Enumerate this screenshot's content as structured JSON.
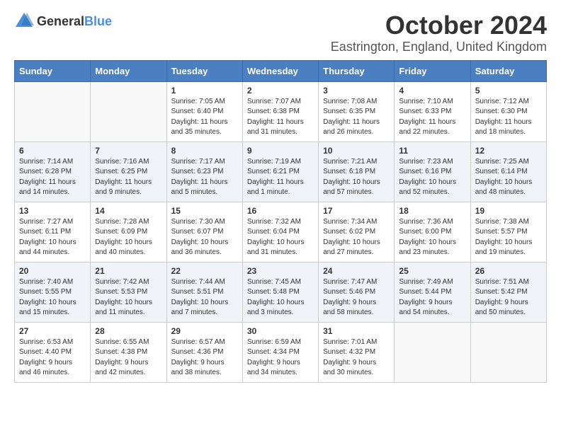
{
  "logo": {
    "text_general": "General",
    "text_blue": "Blue"
  },
  "header": {
    "month": "October 2024",
    "location": "Eastrington, England, United Kingdom"
  },
  "days_of_week": [
    "Sunday",
    "Monday",
    "Tuesday",
    "Wednesday",
    "Thursday",
    "Friday",
    "Saturday"
  ],
  "weeks": [
    [
      {
        "day": null
      },
      {
        "day": null
      },
      {
        "day": "1",
        "sunrise": "Sunrise: 7:05 AM",
        "sunset": "Sunset: 6:40 PM",
        "daylight": "Daylight: 11 hours and 35 minutes."
      },
      {
        "day": "2",
        "sunrise": "Sunrise: 7:07 AM",
        "sunset": "Sunset: 6:38 PM",
        "daylight": "Daylight: 11 hours and 31 minutes."
      },
      {
        "day": "3",
        "sunrise": "Sunrise: 7:08 AM",
        "sunset": "Sunset: 6:35 PM",
        "daylight": "Daylight: 11 hours and 26 minutes."
      },
      {
        "day": "4",
        "sunrise": "Sunrise: 7:10 AM",
        "sunset": "Sunset: 6:33 PM",
        "daylight": "Daylight: 11 hours and 22 minutes."
      },
      {
        "day": "5",
        "sunrise": "Sunrise: 7:12 AM",
        "sunset": "Sunset: 6:30 PM",
        "daylight": "Daylight: 11 hours and 18 minutes."
      }
    ],
    [
      {
        "day": "6",
        "sunrise": "Sunrise: 7:14 AM",
        "sunset": "Sunset: 6:28 PM",
        "daylight": "Daylight: 11 hours and 14 minutes."
      },
      {
        "day": "7",
        "sunrise": "Sunrise: 7:16 AM",
        "sunset": "Sunset: 6:25 PM",
        "daylight": "Daylight: 11 hours and 9 minutes."
      },
      {
        "day": "8",
        "sunrise": "Sunrise: 7:17 AM",
        "sunset": "Sunset: 6:23 PM",
        "daylight": "Daylight: 11 hours and 5 minutes."
      },
      {
        "day": "9",
        "sunrise": "Sunrise: 7:19 AM",
        "sunset": "Sunset: 6:21 PM",
        "daylight": "Daylight: 11 hours and 1 minute."
      },
      {
        "day": "10",
        "sunrise": "Sunrise: 7:21 AM",
        "sunset": "Sunset: 6:18 PM",
        "daylight": "Daylight: 10 hours and 57 minutes."
      },
      {
        "day": "11",
        "sunrise": "Sunrise: 7:23 AM",
        "sunset": "Sunset: 6:16 PM",
        "daylight": "Daylight: 10 hours and 52 minutes."
      },
      {
        "day": "12",
        "sunrise": "Sunrise: 7:25 AM",
        "sunset": "Sunset: 6:14 PM",
        "daylight": "Daylight: 10 hours and 48 minutes."
      }
    ],
    [
      {
        "day": "13",
        "sunrise": "Sunrise: 7:27 AM",
        "sunset": "Sunset: 6:11 PM",
        "daylight": "Daylight: 10 hours and 44 minutes."
      },
      {
        "day": "14",
        "sunrise": "Sunrise: 7:28 AM",
        "sunset": "Sunset: 6:09 PM",
        "daylight": "Daylight: 10 hours and 40 minutes."
      },
      {
        "day": "15",
        "sunrise": "Sunrise: 7:30 AM",
        "sunset": "Sunset: 6:07 PM",
        "daylight": "Daylight: 10 hours and 36 minutes."
      },
      {
        "day": "16",
        "sunrise": "Sunrise: 7:32 AM",
        "sunset": "Sunset: 6:04 PM",
        "daylight": "Daylight: 10 hours and 31 minutes."
      },
      {
        "day": "17",
        "sunrise": "Sunrise: 7:34 AM",
        "sunset": "Sunset: 6:02 PM",
        "daylight": "Daylight: 10 hours and 27 minutes."
      },
      {
        "day": "18",
        "sunrise": "Sunrise: 7:36 AM",
        "sunset": "Sunset: 6:00 PM",
        "daylight": "Daylight: 10 hours and 23 minutes."
      },
      {
        "day": "19",
        "sunrise": "Sunrise: 7:38 AM",
        "sunset": "Sunset: 5:57 PM",
        "daylight": "Daylight: 10 hours and 19 minutes."
      }
    ],
    [
      {
        "day": "20",
        "sunrise": "Sunrise: 7:40 AM",
        "sunset": "Sunset: 5:55 PM",
        "daylight": "Daylight: 10 hours and 15 minutes."
      },
      {
        "day": "21",
        "sunrise": "Sunrise: 7:42 AM",
        "sunset": "Sunset: 5:53 PM",
        "daylight": "Daylight: 10 hours and 11 minutes."
      },
      {
        "day": "22",
        "sunrise": "Sunrise: 7:44 AM",
        "sunset": "Sunset: 5:51 PM",
        "daylight": "Daylight: 10 hours and 7 minutes."
      },
      {
        "day": "23",
        "sunrise": "Sunrise: 7:45 AM",
        "sunset": "Sunset: 5:48 PM",
        "daylight": "Daylight: 10 hours and 3 minutes."
      },
      {
        "day": "24",
        "sunrise": "Sunrise: 7:47 AM",
        "sunset": "Sunset: 5:46 PM",
        "daylight": "Daylight: 9 hours and 58 minutes."
      },
      {
        "day": "25",
        "sunrise": "Sunrise: 7:49 AM",
        "sunset": "Sunset: 5:44 PM",
        "daylight": "Daylight: 9 hours and 54 minutes."
      },
      {
        "day": "26",
        "sunrise": "Sunrise: 7:51 AM",
        "sunset": "Sunset: 5:42 PM",
        "daylight": "Daylight: 9 hours and 50 minutes."
      }
    ],
    [
      {
        "day": "27",
        "sunrise": "Sunrise: 6:53 AM",
        "sunset": "Sunset: 4:40 PM",
        "daylight": "Daylight: 9 hours and 46 minutes."
      },
      {
        "day": "28",
        "sunrise": "Sunrise: 6:55 AM",
        "sunset": "Sunset: 4:38 PM",
        "daylight": "Daylight: 9 hours and 42 minutes."
      },
      {
        "day": "29",
        "sunrise": "Sunrise: 6:57 AM",
        "sunset": "Sunset: 4:36 PM",
        "daylight": "Daylight: 9 hours and 38 minutes."
      },
      {
        "day": "30",
        "sunrise": "Sunrise: 6:59 AM",
        "sunset": "Sunset: 4:34 PM",
        "daylight": "Daylight: 9 hours and 34 minutes."
      },
      {
        "day": "31",
        "sunrise": "Sunrise: 7:01 AM",
        "sunset": "Sunset: 4:32 PM",
        "daylight": "Daylight: 9 hours and 30 minutes."
      },
      {
        "day": null
      },
      {
        "day": null
      }
    ]
  ]
}
